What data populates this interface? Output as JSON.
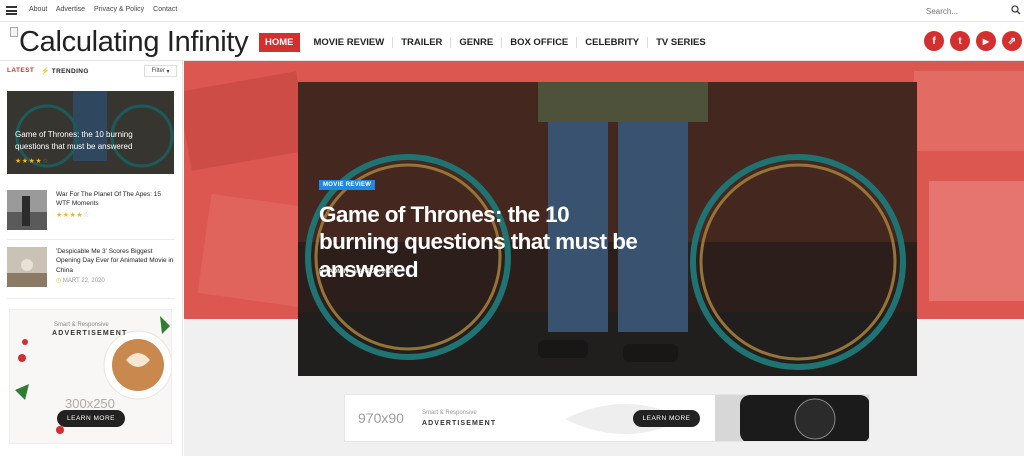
{
  "topbar": {
    "links": [
      "About",
      "Advertise",
      "Privacy & Policy",
      "Contact"
    ],
    "search_placeholder": "Search..."
  },
  "logo": {
    "text": "Calculating Infinity"
  },
  "nav": {
    "items": [
      {
        "label": "HOME",
        "active": true
      },
      {
        "label": "MOVIE REVIEW"
      },
      {
        "label": "TRAILER"
      },
      {
        "label": "GENRE"
      },
      {
        "label": "BOX OFFICE"
      },
      {
        "label": "CELEBRITY"
      },
      {
        "label": "TV SERIES"
      }
    ]
  },
  "social": [
    {
      "icon": "facebook-icon",
      "glyph": "f"
    },
    {
      "icon": "twitter-icon",
      "glyph": "t"
    },
    {
      "icon": "youtube-icon",
      "glyph": "▶"
    },
    {
      "icon": "link-icon",
      "glyph": "⇗"
    }
  ],
  "sidebar": {
    "tab_latest": "LATEST",
    "tab_trending": "TRENDING",
    "filter_label": "Filter",
    "featured": {
      "title": "Game of Thrones: the 10 burning questions that must be answered",
      "rating": 4
    },
    "items": [
      {
        "title": "War For The Planet Of The Apes: 15 WTF Moments",
        "rating": 4
      },
      {
        "title": "'Despicable Me 3' Scores Biggest Opening Day Ever for Animated Movie in China",
        "date": "MART 22, 2020"
      }
    ],
    "ad": {
      "subtitle": "Smart & Responsive",
      "title": "ADVERTISEMENT",
      "size": "300x250",
      "button": "LEARN MORE"
    }
  },
  "hero": {
    "badge": "MOVIE REVIEW",
    "title": "Game of Thrones: the 10 burning questions that must be answered",
    "meta_by": "BY",
    "meta_author": "ADMIN",
    "meta_date": "MART 24, 2020"
  },
  "ad_banner": {
    "size": "970x90",
    "subtitle": "Smart & Responsive",
    "title": "ADVERTISEMENT",
    "button": "LEARN MORE"
  },
  "colors": {
    "accent": "#d32f2f",
    "badge": "#1e88e5",
    "star": "#f2b51c"
  }
}
